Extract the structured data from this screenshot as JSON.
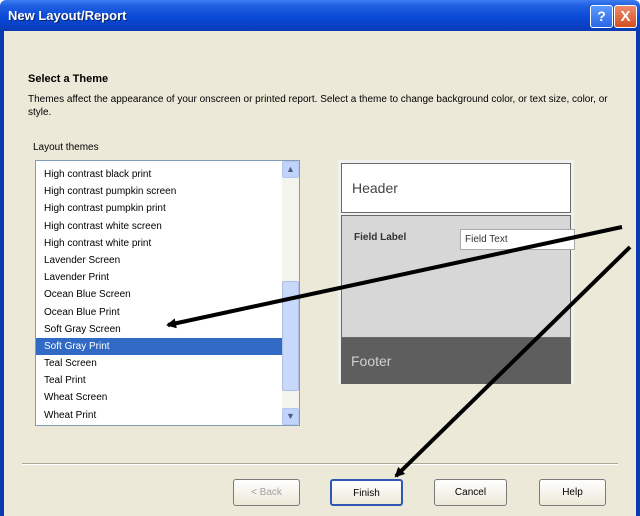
{
  "window": {
    "title": "New Layout/Report",
    "help_glyph": "?",
    "close_glyph": "X"
  },
  "page": {
    "heading": "Select a Theme",
    "description": "Themes affect the appearance of your onscreen or printed report. Select a theme to change background color, or text size, color, or style.",
    "list_caption": "Layout themes"
  },
  "themes": {
    "items": [
      {
        "label": "High contrast black print"
      },
      {
        "label": "High contrast pumpkin screen"
      },
      {
        "label": "High contrast pumpkin print"
      },
      {
        "label": "High contrast white screen"
      },
      {
        "label": "High contrast white print"
      },
      {
        "label": "Lavender Screen"
      },
      {
        "label": "Lavender Print"
      },
      {
        "label": "Ocean Blue Screen"
      },
      {
        "label": "Ocean Blue Print"
      },
      {
        "label": "Soft Gray Screen"
      },
      {
        "label": "Soft Gray Print"
      },
      {
        "label": "Teal Screen"
      },
      {
        "label": "Teal Print"
      },
      {
        "label": "Wheat Screen"
      },
      {
        "label": "Wheat Print"
      }
    ],
    "selected_label": "Soft Gray Print"
  },
  "preview": {
    "header": "Header",
    "field_label": "Field Label",
    "field_text": "Field Text",
    "footer": "Footer"
  },
  "buttons": {
    "back": "< Back",
    "finish": "Finish",
    "cancel": "Cancel",
    "help": "Help"
  },
  "colors": {
    "title_bar": "#0a4ad6",
    "selection": "#316ac5",
    "dialog_bg": "#ece9d8",
    "annotation_arrows": "#000000"
  }
}
